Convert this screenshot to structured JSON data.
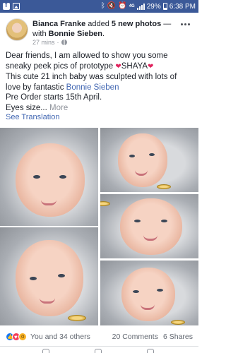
{
  "status_bar": {
    "network": "4G",
    "battery": "29%",
    "time": "6:38 PM"
  },
  "post": {
    "author": "Bianca Franke",
    "action_text": " added ",
    "photo_count_text": "5 new photos",
    "with_text": " — with ",
    "tagged": "Bonnie Sieben",
    "tagged_suffix": ".",
    "timestamp": "27 mins",
    "body": {
      "line1": "Dear friends, I am allowed to show you some sneaky peek pics of prototype ",
      "name_tag": "SHAYA",
      "line2": "This cute 21 inch baby was sculpted with lots of love by fantastic ",
      "artist": "Bonnie Sieben",
      "line3": "Pre Order starts 15th April.",
      "line4": "Eyes size...",
      "more": "More"
    },
    "see_translation": "See Translation"
  },
  "photos": [
    {
      "label": "baby-photo-1"
    },
    {
      "label": "baby-photo-2"
    },
    {
      "label": "baby-photo-3"
    },
    {
      "label": "baby-photo-4"
    },
    {
      "label": "baby-photo-5"
    }
  ],
  "reactions": {
    "types": [
      "like",
      "love",
      "wow"
    ],
    "summary": "You and 34 others",
    "comments": "20 Comments",
    "shares": "6 Shares"
  },
  "colors": {
    "brand": "#3b5998",
    "link": "#4267b2",
    "meta": "#90949c"
  }
}
